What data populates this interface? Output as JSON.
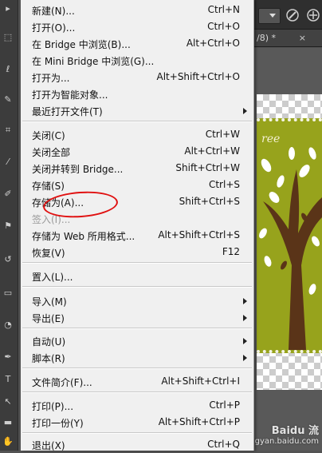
{
  "menu": {
    "items": [
      {
        "label": "新建(N)...",
        "shortcut": "Ctrl+N"
      },
      {
        "label": "打开(O)...",
        "shortcut": "Ctrl+O"
      },
      {
        "label": "在 Bridge 中浏览(B)...",
        "shortcut": "Alt+Ctrl+O"
      },
      {
        "label": "在 Mini Bridge 中浏览(G)...",
        "shortcut": ""
      },
      {
        "label": "打开为...",
        "shortcut": "Alt+Shift+Ctrl+O"
      },
      {
        "label": "打开为智能对象...",
        "shortcut": ""
      },
      {
        "label": "最近打开文件(T)",
        "shortcut": ""
      },
      {
        "label": "关闭(C)",
        "shortcut": "Ctrl+W"
      },
      {
        "label": "关闭全部",
        "shortcut": "Alt+Ctrl+W"
      },
      {
        "label": "关闭并转到 Bridge...",
        "shortcut": "Shift+Ctrl+W"
      },
      {
        "label": "存储(S)",
        "shortcut": "Ctrl+S"
      },
      {
        "label": "存储为(A)...",
        "shortcut": "Shift+Ctrl+S"
      },
      {
        "label": "签入(I)...",
        "shortcut": ""
      },
      {
        "label": "存储为 Web 所用格式...",
        "shortcut": "Alt+Shift+Ctrl+S"
      },
      {
        "label": "恢复(V)",
        "shortcut": "F12"
      },
      {
        "label": "置入(L)...",
        "shortcut": ""
      },
      {
        "label": "导入(M)",
        "shortcut": ""
      },
      {
        "label": "导出(E)",
        "shortcut": ""
      },
      {
        "label": "自动(U)",
        "shortcut": ""
      },
      {
        "label": "脚本(R)",
        "shortcut": ""
      },
      {
        "label": "文件简介(F)...",
        "shortcut": "Alt+Shift+Ctrl+I"
      },
      {
        "label": "打印(P)...",
        "shortcut": "Ctrl+P"
      },
      {
        "label": "打印一份(Y)",
        "shortcut": "Alt+Shift+Ctrl+P"
      },
      {
        "label": "退出(X)",
        "shortcut": "Ctrl+Q"
      }
    ]
  },
  "document_tab": {
    "label": "/8) *",
    "close": "×"
  },
  "artwork": {
    "title": "ree"
  },
  "watermark": {
    "title": "Baidu 流",
    "url": "jingyan.baidu.com"
  },
  "colors": {
    "menu_bg": "#f0f0f0",
    "highlight": "#e01010",
    "artwork_green": "#97a31c",
    "trunk": "#5a3418"
  }
}
